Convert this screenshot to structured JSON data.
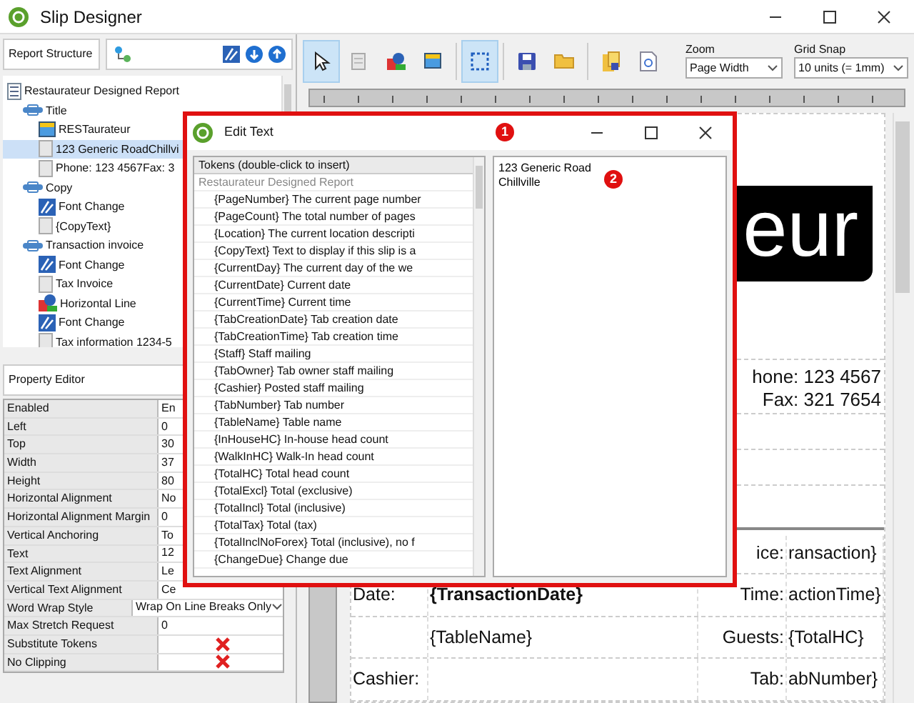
{
  "window": {
    "title": "Slip Designer"
  },
  "report_structure": {
    "title": "Report Structure",
    "tree": [
      {
        "label": "Restaurateur Designed Report",
        "kind": "report",
        "selected": false,
        "children": [
          {
            "label": "Title",
            "kind": "band",
            "selected": false,
            "children": [
              {
                "label": "RESTaurateur",
                "kind": "picture",
                "selected": false
              },
              {
                "label": "123 Generic RoadChillvi",
                "kind": "text",
                "selected": true
              },
              {
                "label": "Phone: 123 4567Fax: 3",
                "kind": "text",
                "selected": false
              }
            ]
          },
          {
            "label": "Copy",
            "kind": "band",
            "selected": false,
            "children": [
              {
                "label": "Font Change",
                "kind": "font",
                "selected": false
              },
              {
                "label": "{CopyText}",
                "kind": "text",
                "selected": false
              }
            ]
          },
          {
            "label": "Transaction invoice",
            "kind": "band",
            "selected": false,
            "children": [
              {
                "label": "Font Change",
                "kind": "font",
                "selected": false
              },
              {
                "label": "Tax Invoice",
                "kind": "text",
                "selected": false
              },
              {
                "label": "Horizontal Line",
                "kind": "line",
                "selected": false
              },
              {
                "label": "Font Change",
                "kind": "font",
                "selected": false
              },
              {
                "label": "Tax information 1234-5",
                "kind": "text",
                "selected": false
              }
            ]
          }
        ]
      }
    ]
  },
  "property_editor": {
    "title": "Property Editor",
    "rows": [
      {
        "name": "Enabled",
        "kind": "text",
        "value": "En"
      },
      {
        "name": "Left",
        "kind": "text",
        "value": "0"
      },
      {
        "name": "Top",
        "kind": "text",
        "value": "30"
      },
      {
        "name": "Width",
        "kind": "text",
        "value": "37"
      },
      {
        "name": "Height",
        "kind": "text",
        "value": "80"
      },
      {
        "name": "Horizontal Alignment",
        "kind": "text",
        "value": "No"
      },
      {
        "name": "Horizontal Alignment Margin",
        "kind": "text",
        "value": "0"
      },
      {
        "name": "Vertical Anchoring",
        "kind": "text",
        "value": "To"
      },
      {
        "name": "Text",
        "kind": "text",
        "value": "12"
      },
      {
        "name": "Text Alignment",
        "kind": "text",
        "value": "Le"
      },
      {
        "name": "Vertical Text Alignment",
        "kind": "text",
        "value": "Ce"
      },
      {
        "name": "Word Wrap Style",
        "kind": "dropdown",
        "value": "Wrap On Line Breaks Only"
      },
      {
        "name": "Max Stretch Request",
        "kind": "text",
        "value": "0"
      },
      {
        "name": "Substitute Tokens",
        "kind": "cross"
      },
      {
        "name": "No Clipping",
        "kind": "cross"
      }
    ]
  },
  "toolbar": {
    "groups": [
      {
        "tools": [
          {
            "kind": "pointer",
            "selected": true
          },
          {
            "kind": "page",
            "selected": false
          },
          {
            "kind": "shapes",
            "selected": false
          },
          {
            "kind": "picture",
            "selected": false
          }
        ]
      },
      {
        "tools": [
          {
            "kind": "marquee",
            "selected": true
          }
        ]
      },
      {
        "tools": [
          {
            "kind": "save",
            "selected": false
          },
          {
            "kind": "folder",
            "selected": false
          }
        ]
      },
      {
        "tools": [
          {
            "kind": "documents",
            "selected": false
          },
          {
            "kind": "document_search",
            "selected": false
          }
        ]
      }
    ],
    "zoom": {
      "label": "Zoom",
      "value": "Page Width"
    },
    "grid_snap": {
      "label": "Grid Snap",
      "value": "10 units (= 1mm)"
    }
  },
  "canvas": {
    "logo_text": "eur",
    "phone_lines": [
      "hone: 123 4567",
      "Fax: 321 7654"
    ],
    "rows": [
      {
        "right_label": "ice:",
        "right_value": "ransaction}"
      },
      {
        "left_label": "Date:",
        "left_value": "{TransactionDate}",
        "left_value_bold": true,
        "right_label": "Time:",
        "right_value": "actionTime}"
      },
      {
        "left_value": "{TableName}",
        "right_label": "Guests:",
        "right_value": "{TotalHC}"
      },
      {
        "left_label": "Cashier:",
        "right_label": "Tab:",
        "right_value": "abNumber}"
      }
    ]
  },
  "dialog": {
    "title": "Edit Text",
    "highlighted": true,
    "tokens": {
      "header": "Tokens (double-click to insert)",
      "group": "Restaurateur Designed Report",
      "items": [
        "{PageNumber} The current page number",
        "{PageCount} The total number of pages",
        "{Location} The current location descripti",
        "{CopyText} Text to display if this slip is a",
        "{CurrentDay} The current day of the we",
        "{CurrentDate} Current date",
        "{CurrentTime} Current time",
        "{TabCreationDate} Tab creation date",
        "{TabCreationTime} Tab creation time",
        "{Staff} Staff mailing",
        "{TabOwner} Tab owner staff mailing",
        "{Cashier} Posted staff mailing",
        "{TabNumber} Tab number",
        "{TableName} Table name",
        "{InHouseHC} In-house head count",
        "{WalkInHC} Walk-In head count",
        "{TotalHC} Total head count",
        "{TotalExcl} Total (exclusive)",
        "{TotalIncl} Total (inclusive)",
        "{TotalTax} Total (tax)",
        "{TotalInclNoForex} Total (inclusive), no f",
        "{ChangeDue} Change due"
      ]
    },
    "text_value": "123 Generic Road\nChillville"
  },
  "annotations": [
    {
      "label": "1"
    },
    {
      "label": "2"
    }
  ]
}
